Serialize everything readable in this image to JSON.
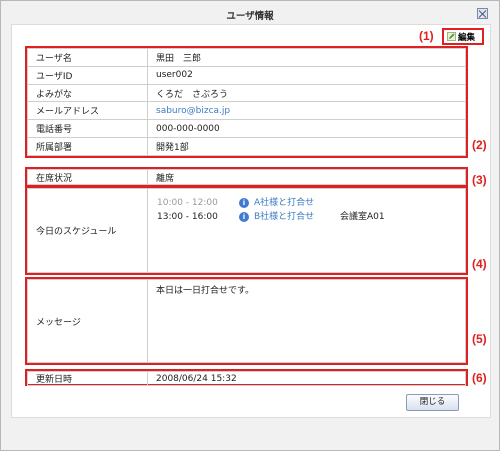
{
  "window": {
    "title": "ユーザ情報"
  },
  "toolbar": {
    "edit_label": "編集"
  },
  "annotations": [
    "(1)",
    "(2)",
    "(3)",
    "(4)",
    "(5)",
    "(6)"
  ],
  "user_info": [
    {
      "label": "ユーザ名",
      "value": "黒田　三郎"
    },
    {
      "label": "ユーザID",
      "value": "user002"
    },
    {
      "label": "よみがな",
      "value": "くろだ　さぶろう"
    },
    {
      "label": "メールアドレス",
      "value": "saburo@bizca.jp"
    },
    {
      "label": "電話番号",
      "value": "000-000-0000"
    },
    {
      "label": "所属部署",
      "value": "開発1部"
    }
  ],
  "presence": {
    "label": "在席状況",
    "value": "離席"
  },
  "schedule": {
    "label": "今日のスケジュール",
    "items": [
      {
        "time": "10:00 - 12:00",
        "title": "A社様と打合せ",
        "place": ""
      },
      {
        "time": "13:00 - 16:00",
        "title": "B社様と打合せ",
        "place": "会議室A01"
      }
    ]
  },
  "message": {
    "label": "メッセージ",
    "value": "本日は一日打合せです。"
  },
  "updated": {
    "label": "更新日時",
    "value": "2008/06/24 15:32"
  },
  "footer": {
    "close_label": "閉じる"
  },
  "colors": {
    "annotation": "#e02020",
    "link": "#3c7bc5",
    "icon": "#3f7bd1"
  }
}
